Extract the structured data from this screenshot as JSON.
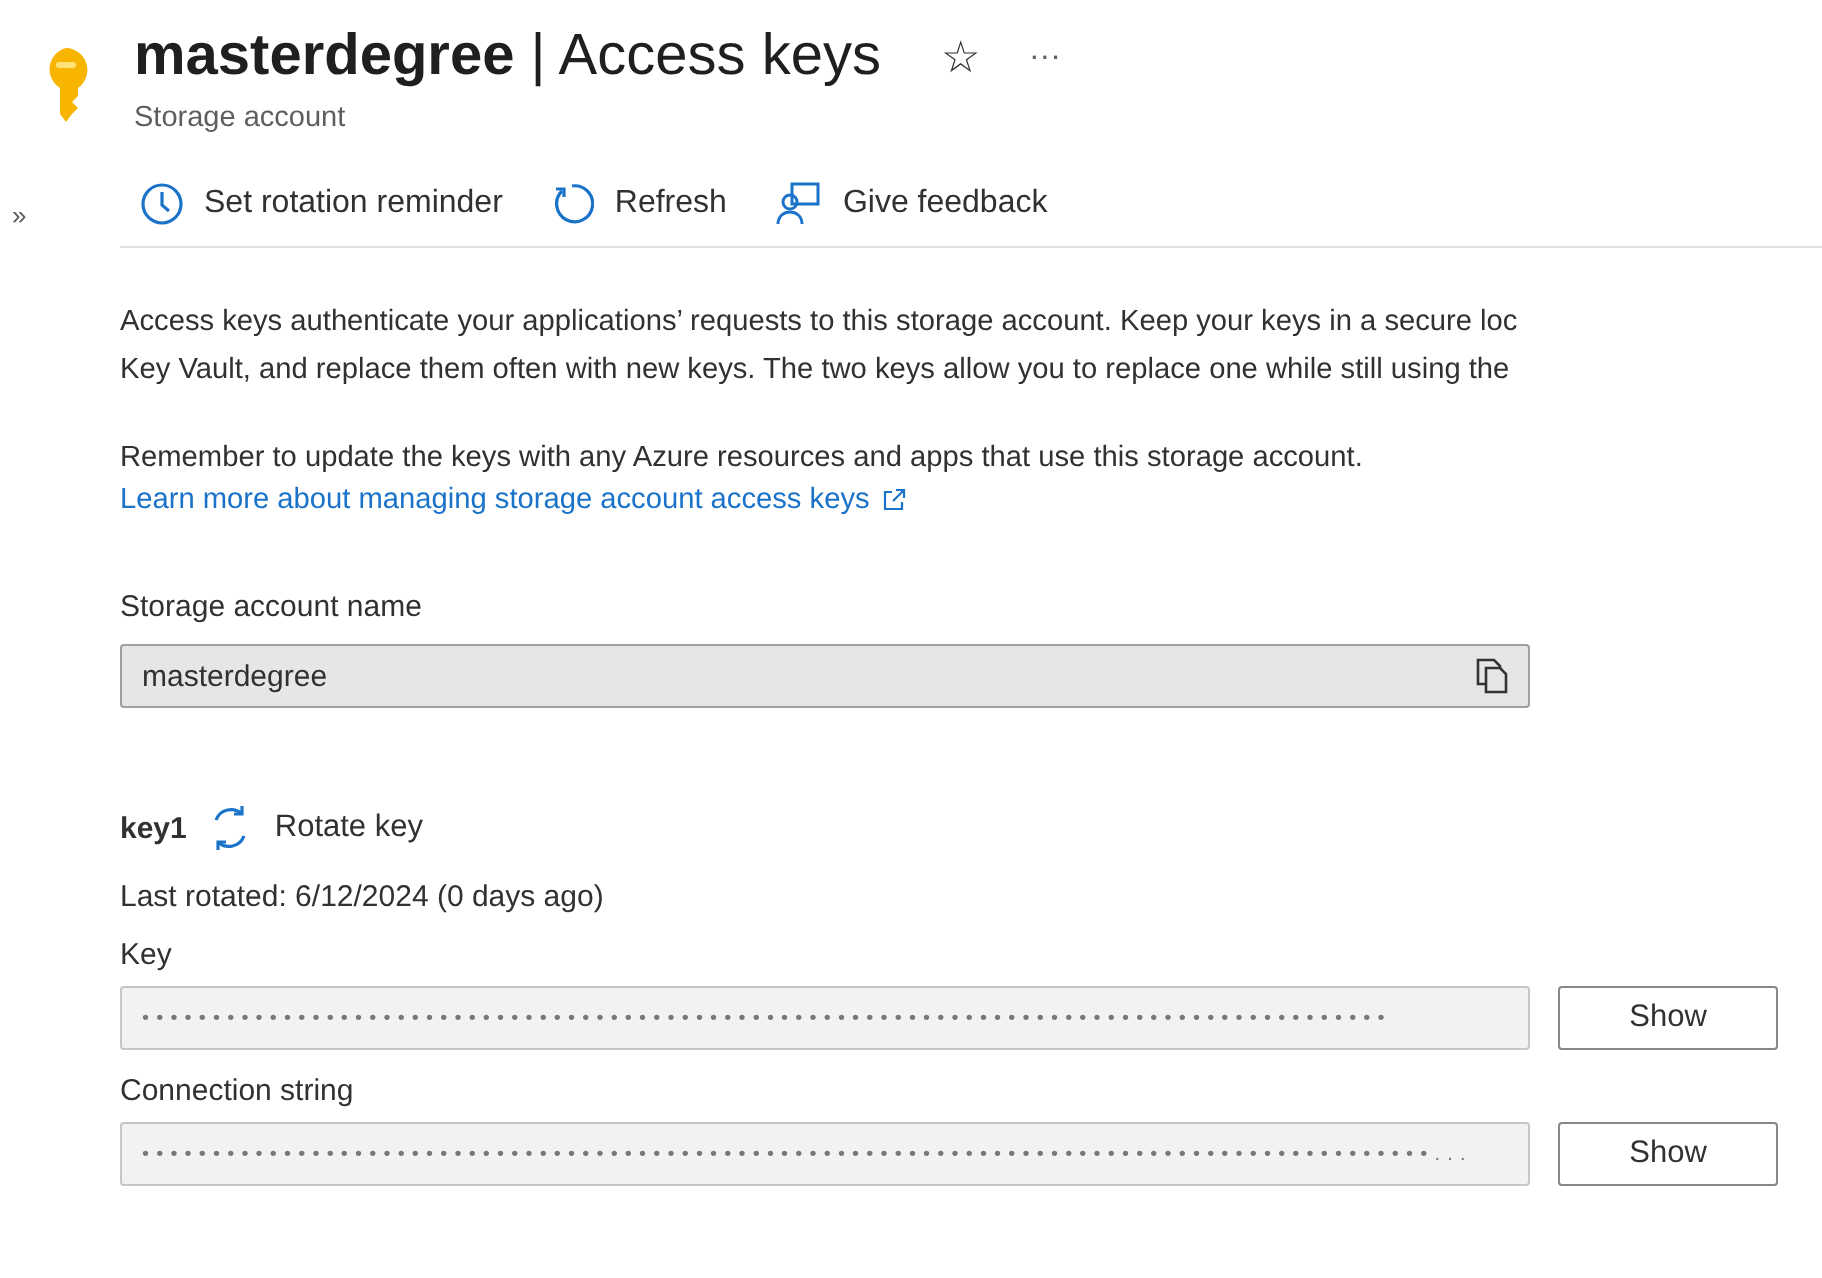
{
  "header": {
    "resource": "masterdegree",
    "separator": "|",
    "page": "Access keys",
    "subtitle": "Storage account",
    "favorite": "☆",
    "more": "···"
  },
  "sidebar": {
    "expand": "»"
  },
  "toolbar": [
    {
      "kind": "clock",
      "label": "Set rotation reminder"
    },
    {
      "kind": "refresh",
      "label": "Refresh"
    },
    {
      "kind": "feedback",
      "label": "Give feedback"
    }
  ],
  "intro": [
    "Access keys authenticate your applications’ requests to this storage account. Keep your keys in a secure loc",
    "Key Vault, and replace them often with new keys. The two keys allow you to replace one while still using the"
  ],
  "reminder": "Remember to update the keys with any Azure resources and apps that use this storage account.",
  "learn_link": "Learn more about managing storage account access keys",
  "account": {
    "label": "Storage account name",
    "value": "masterdegree"
  },
  "key1": {
    "name": "key1",
    "rotate": "Rotate key",
    "last_rotated": "Last rotated: 6/12/2024 (0 days ago)",
    "fields": [
      {
        "label": "Key",
        "value": "••••••••••••••••••••••••••••••••••••••••••••••••••••••••••••••••••••••••••••••••••••••••",
        "button": "Show"
      },
      {
        "label": "Connection string",
        "value": "•••••••••••••••••••••••••••••••••••••••••••••••••••••••••••••••••••••••••••••••••••••••••••...",
        "button": "Show"
      }
    ]
  }
}
